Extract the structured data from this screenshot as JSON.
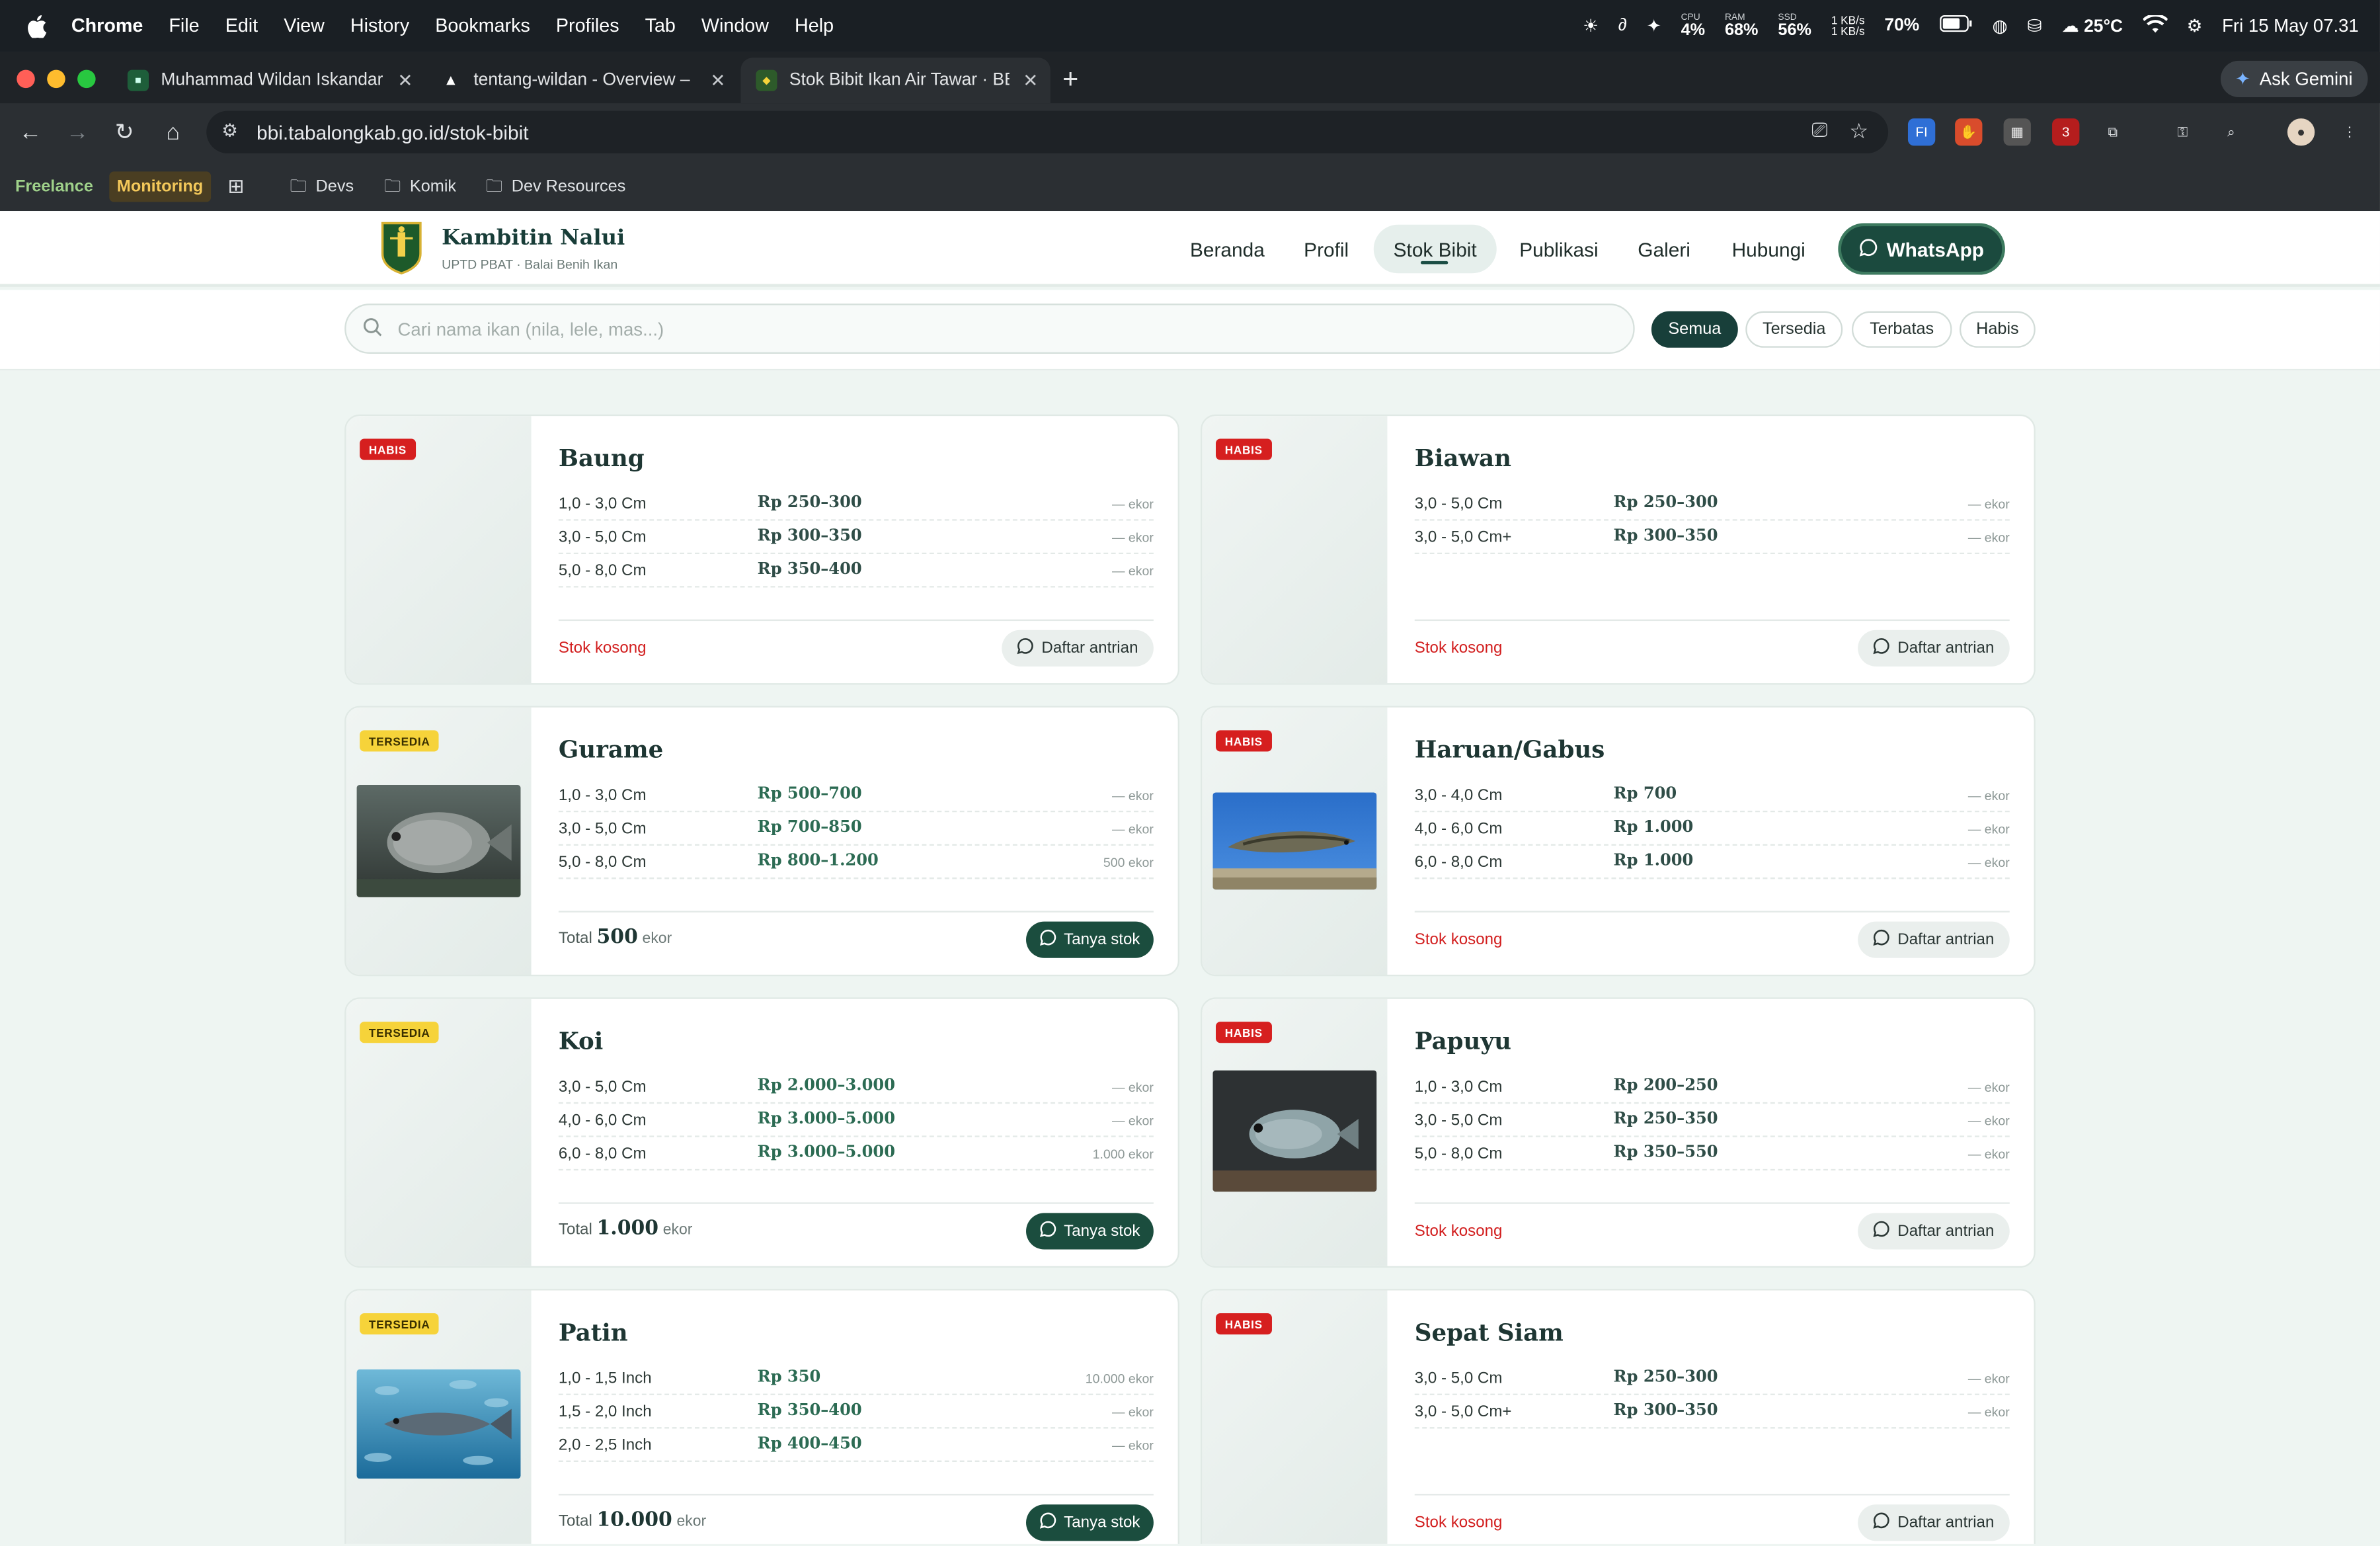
{
  "menubar": {
    "app": "Chrome",
    "items": [
      "File",
      "Edit",
      "View",
      "History",
      "Bookmarks",
      "Profiles",
      "Tab",
      "Window",
      "Help"
    ],
    "cpu_label": "CPU",
    "cpu": "4%",
    "ram_label": "RAM",
    "ram": "68%",
    "ssd_label": "SSD",
    "ssd": "56%",
    "net_up": "1 KB/s",
    "net_down": "1 KB/s",
    "battery": "70%",
    "weather": "25°C",
    "datetime": "Fri 15 May  07.31"
  },
  "browser": {
    "tabs": [
      {
        "title": "Muhammad Wildan Iskandar |"
      },
      {
        "title": "tentang-wildan - Overview – "
      },
      {
        "title": "Stok Bibit Ikan Air Tawar · BBI"
      }
    ],
    "ask_gemini": "Ask Gemini",
    "url": "bbi.tabalongkab.go.id/stok-bibit",
    "ext_badge": "3",
    "bookmarks": {
      "freelance": "Freelance",
      "monitoring": "Monitoring",
      "devs": "Devs",
      "komik": "Komik",
      "dev_resources": "Dev Resources"
    }
  },
  "site": {
    "brand": "Kambitin Nalui",
    "brand_sub": "UPTD PBAT · Balai Benih Ikan",
    "nav": [
      "Beranda",
      "Profil",
      "Stok Bibit",
      "Publikasi",
      "Galeri",
      "Hubungi"
    ],
    "whatsapp": "WhatsApp",
    "search_placeholder": "Cari nama ikan (nila, lele, mas...)",
    "filters": [
      "Semua",
      "Tersedia",
      "Terbatas",
      "Habis"
    ],
    "total_label": "Total",
    "unit": "ekor"
  },
  "cards": [
    {
      "name": "Baung",
      "badge": "HABIS",
      "status": "habis",
      "photo": false,
      "rows": [
        {
          "size": "1,0 - 3,0 Cm",
          "price": "Rp 250–300",
          "stock": "— ekor"
        },
        {
          "size": "3,0 - 5,0 Cm",
          "price": "Rp 300–350",
          "stock": "— ekor"
        },
        {
          "size": "5,0 - 8,0 Cm",
          "price": "Rp 350–400",
          "stock": "— ekor"
        }
      ],
      "footer": "Stok kosong",
      "button": "Daftar antrian"
    },
    {
      "name": "Biawan",
      "badge": "HABIS",
      "status": "habis",
      "photo": false,
      "rows": [
        {
          "size": "3,0 - 5,0 Cm",
          "price": "Rp 250–300",
          "stock": "— ekor"
        },
        {
          "size": "3,0 - 5,0 Cm+",
          "price": "Rp 300–350",
          "stock": "— ekor"
        }
      ],
      "footer": "Stok kosong",
      "button": "Daftar antrian"
    },
    {
      "name": "Gurame",
      "badge": "TERSEDIA",
      "status": "tersedia",
      "photo": "gurame",
      "rows": [
        {
          "size": "1,0 - 3,0 Cm",
          "price": "Rp 500–700",
          "stock": "— ekor"
        },
        {
          "size": "3,0 - 5,0 Cm",
          "price": "Rp 700–850",
          "stock": "— ekor"
        },
        {
          "size": "5,0 - 8,0 Cm",
          "price": "Rp 800–1.200",
          "stock": "500 ekor"
        }
      ],
      "total": "500",
      "button": "Tanya stok"
    },
    {
      "name": "Haruan/Gabus",
      "badge": "HABIS",
      "status": "habis",
      "photo": "haruan",
      "rows": [
        {
          "size": "3,0 - 4,0 Cm",
          "price": "Rp 700",
          "stock": "— ekor"
        },
        {
          "size": "4,0 - 6,0 Cm",
          "price": "Rp 1.000",
          "stock": "— ekor"
        },
        {
          "size": "6,0 - 8,0 Cm",
          "price": "Rp 1.000",
          "stock": "— ekor"
        }
      ],
      "footer": "Stok kosong",
      "button": "Daftar antrian"
    },
    {
      "name": "Koi",
      "badge": "TERSEDIA",
      "status": "tersedia",
      "photo": false,
      "rows": [
        {
          "size": "3,0 - 5,0 Cm",
          "price": "Rp 2.000–3.000",
          "stock": "— ekor"
        },
        {
          "size": "4,0 - 6,0 Cm",
          "price": "Rp 3.000–5.000",
          "stock": "— ekor"
        },
        {
          "size": "6,0 - 8,0 Cm",
          "price": "Rp 3.000–5.000",
          "stock": "1.000 ekor"
        }
      ],
      "total": "1.000",
      "button": "Tanya stok"
    },
    {
      "name": "Papuyu",
      "badge": "HABIS",
      "status": "habis",
      "photo": "papuyu",
      "rows": [
        {
          "size": "1,0 - 3,0 Cm",
          "price": "Rp 200–250",
          "stock": "— ekor"
        },
        {
          "size": "3,0 - 5,0 Cm",
          "price": "Rp 250–350",
          "stock": "— ekor"
        },
        {
          "size": "5,0 - 8,0 Cm",
          "price": "Rp 350–550",
          "stock": "— ekor"
        }
      ],
      "footer": "Stok kosong",
      "button": "Daftar antrian"
    },
    {
      "name": "Patin",
      "badge": "TERSEDIA",
      "status": "tersedia",
      "photo": "patin",
      "rows": [
        {
          "size": "1,0 - 1,5 Inch",
          "price": "Rp 350",
          "stock": "10.000 ekor"
        },
        {
          "size": "1,5 - 2,0 Inch",
          "price": "Rp 350–400",
          "stock": "— ekor"
        },
        {
          "size": "2,0 - 2,5 Inch",
          "price": "Rp 400–450",
          "stock": "— ekor"
        }
      ],
      "total": "10.000",
      "button": "Tanya stok"
    },
    {
      "name": "Sepat Siam",
      "badge": "HABIS",
      "status": "habis",
      "photo": false,
      "rows": [
        {
          "size": "3,0 - 5,0 Cm",
          "price": "Rp 250–300",
          "stock": "— ekor"
        },
        {
          "size": "3,0 - 5,0 Cm+",
          "price": "Rp 300–350",
          "stock": "— ekor"
        }
      ],
      "footer": "Stok kosong",
      "button": "Daftar antrian"
    }
  ]
}
